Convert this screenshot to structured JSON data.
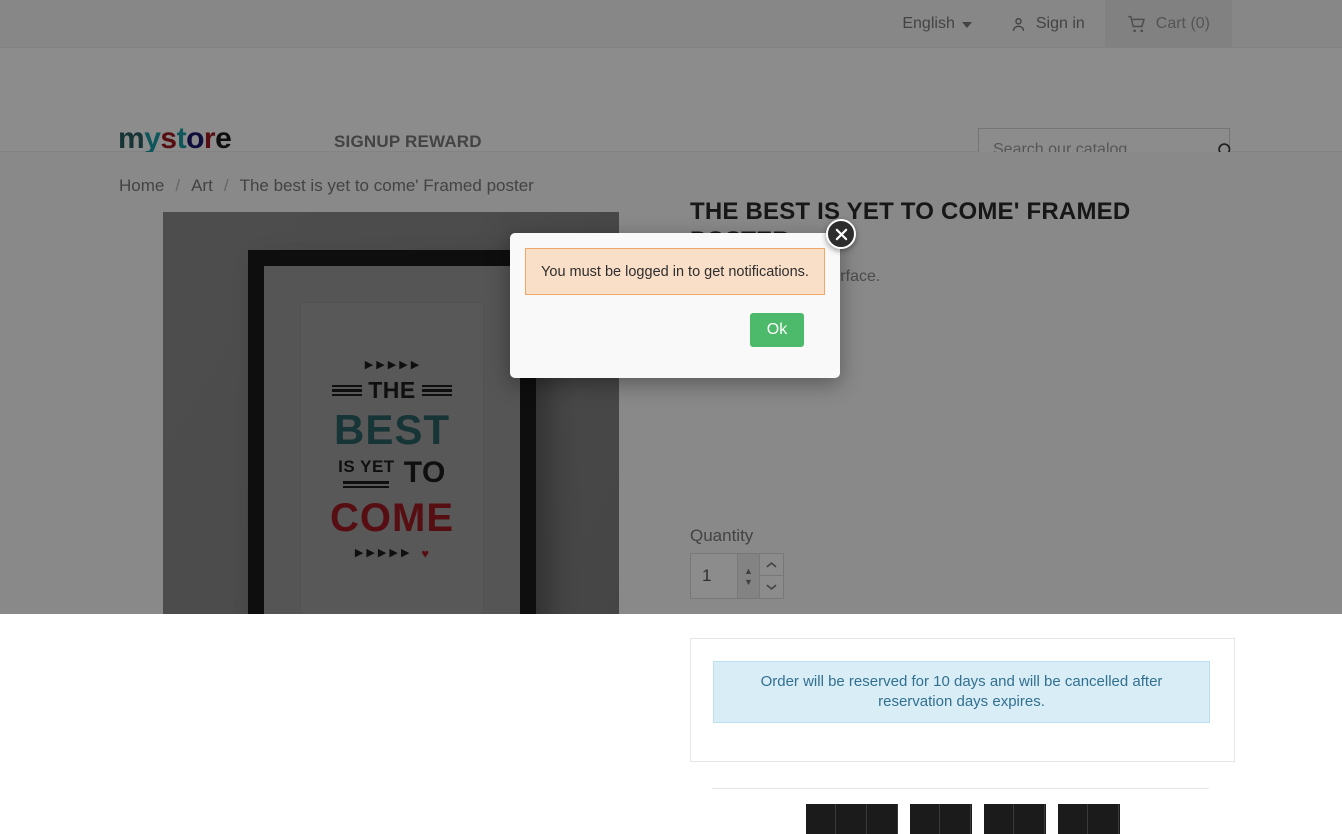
{
  "topbar": {
    "language": "English",
    "language_icon": "chevron-down-icon",
    "signin_label": "Sign in",
    "signin_icon": "user-icon",
    "cart_label": "Cart (0)",
    "cart_icon": "shopping-cart-icon"
  },
  "header": {
    "logo_parts": [
      {
        "text": "m",
        "color": "#2b5f63"
      },
      {
        "text": "y",
        "color": "#1b9ba8"
      },
      {
        "text": " ",
        "color": "#2b2b2b"
      },
      {
        "text": "s",
        "color": "#9e1b23"
      },
      {
        "text": "t",
        "color": "#1b9ba8"
      },
      {
        "text": "o",
        "color": "#1a1a6e"
      },
      {
        "text": "r",
        "color": "#9e1b23"
      },
      {
        "text": "e",
        "color": "#1d1d1d"
      }
    ],
    "logo_text": "my store",
    "nav_link": "SIGNUP REWARD",
    "search_placeholder": "Search our catalog",
    "search_value": "",
    "search_icon": "search-icon"
  },
  "breadcrumb": {
    "items": [
      {
        "label": "Home"
      },
      {
        "label": "Art"
      },
      {
        "label": "The best is yet to come' Framed poster"
      }
    ],
    "separator": "/"
  },
  "product_image": {
    "alt": "The best is yet to come framed poster on wall",
    "poster": {
      "top_triangles": "▶ ▶ ▶ ▶ ▶",
      "line1": "THE",
      "line2": "BEST",
      "line3a": "IS YET",
      "line3b": "TO",
      "line4": "COME",
      "bottom_triangles": "▶ ▶ ▶ ▶ ▶",
      "heart": "♥",
      "color_best": "#2b5f63",
      "color_come": "#9e1b23"
    }
  },
  "product": {
    "title": "The best is yet to come' Framed poster",
    "description": "... per and smooth surface.",
    "quantity_label": "Quantity",
    "quantity_value": "1",
    "qty_up_icon": "chevron-up-icon",
    "qty_down_icon": "chevron-down-icon",
    "reserve_notice": "Order will be reserved for 10 days and will be cancelled after reservation days expires."
  },
  "modal": {
    "message": "You must be logged in to get notifications.",
    "ok_label": "Ok",
    "close_icon": "close-icon",
    "close_label": "✖",
    "alert_bg": "#fadfc8",
    "alert_border": "#f0a868",
    "ok_color": "#4cb96b"
  }
}
